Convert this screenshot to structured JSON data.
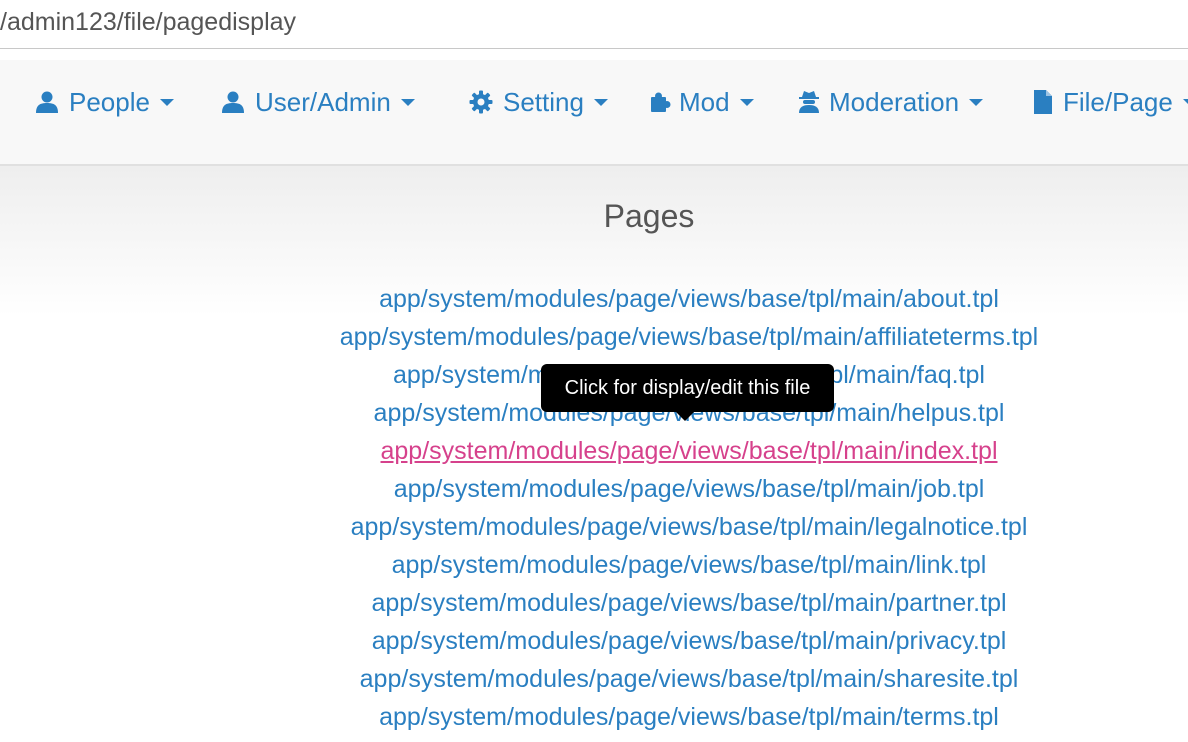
{
  "address_bar": {
    "url": "/admin123/file/pagedisplay"
  },
  "navbar": {
    "items": [
      {
        "label": "People",
        "icon": "user-icon"
      },
      {
        "label": "User/Admin",
        "icon": "user-icon"
      },
      {
        "label": "Setting",
        "icon": "gear-icon"
      },
      {
        "label": "Mod",
        "icon": "puzzle-icon"
      },
      {
        "label": "Moderation",
        "icon": "user-secret-icon"
      },
      {
        "label": "File/Page",
        "icon": "file-icon"
      }
    ],
    "color": "#2a7fc1"
  },
  "main": {
    "title": "Pages",
    "files": [
      "app/system/modules/page/views/base/tpl/main/about.tpl",
      "app/system/modules/page/views/base/tpl/main/affiliateterms.tpl",
      "app/system/modules/page/views/base/tpl/main/faq.tpl",
      "app/system/modules/page/views/base/tpl/main/helpus.tpl",
      "app/system/modules/page/views/base/tpl/main/index.tpl",
      "app/system/modules/page/views/base/tpl/main/job.tpl",
      "app/system/modules/page/views/base/tpl/main/legalnotice.tpl",
      "app/system/modules/page/views/base/tpl/main/link.tpl",
      "app/system/modules/page/views/base/tpl/main/partner.tpl",
      "app/system/modules/page/views/base/tpl/main/privacy.tpl",
      "app/system/modules/page/views/base/tpl/main/sharesite.tpl",
      "app/system/modules/page/views/base/tpl/main/terms.tpl"
    ],
    "hovered_index": 4,
    "link_color": "#2a7fc1",
    "hover_color": "#d6418c"
  },
  "tooltip": {
    "text": "Click for display/edit this file"
  }
}
